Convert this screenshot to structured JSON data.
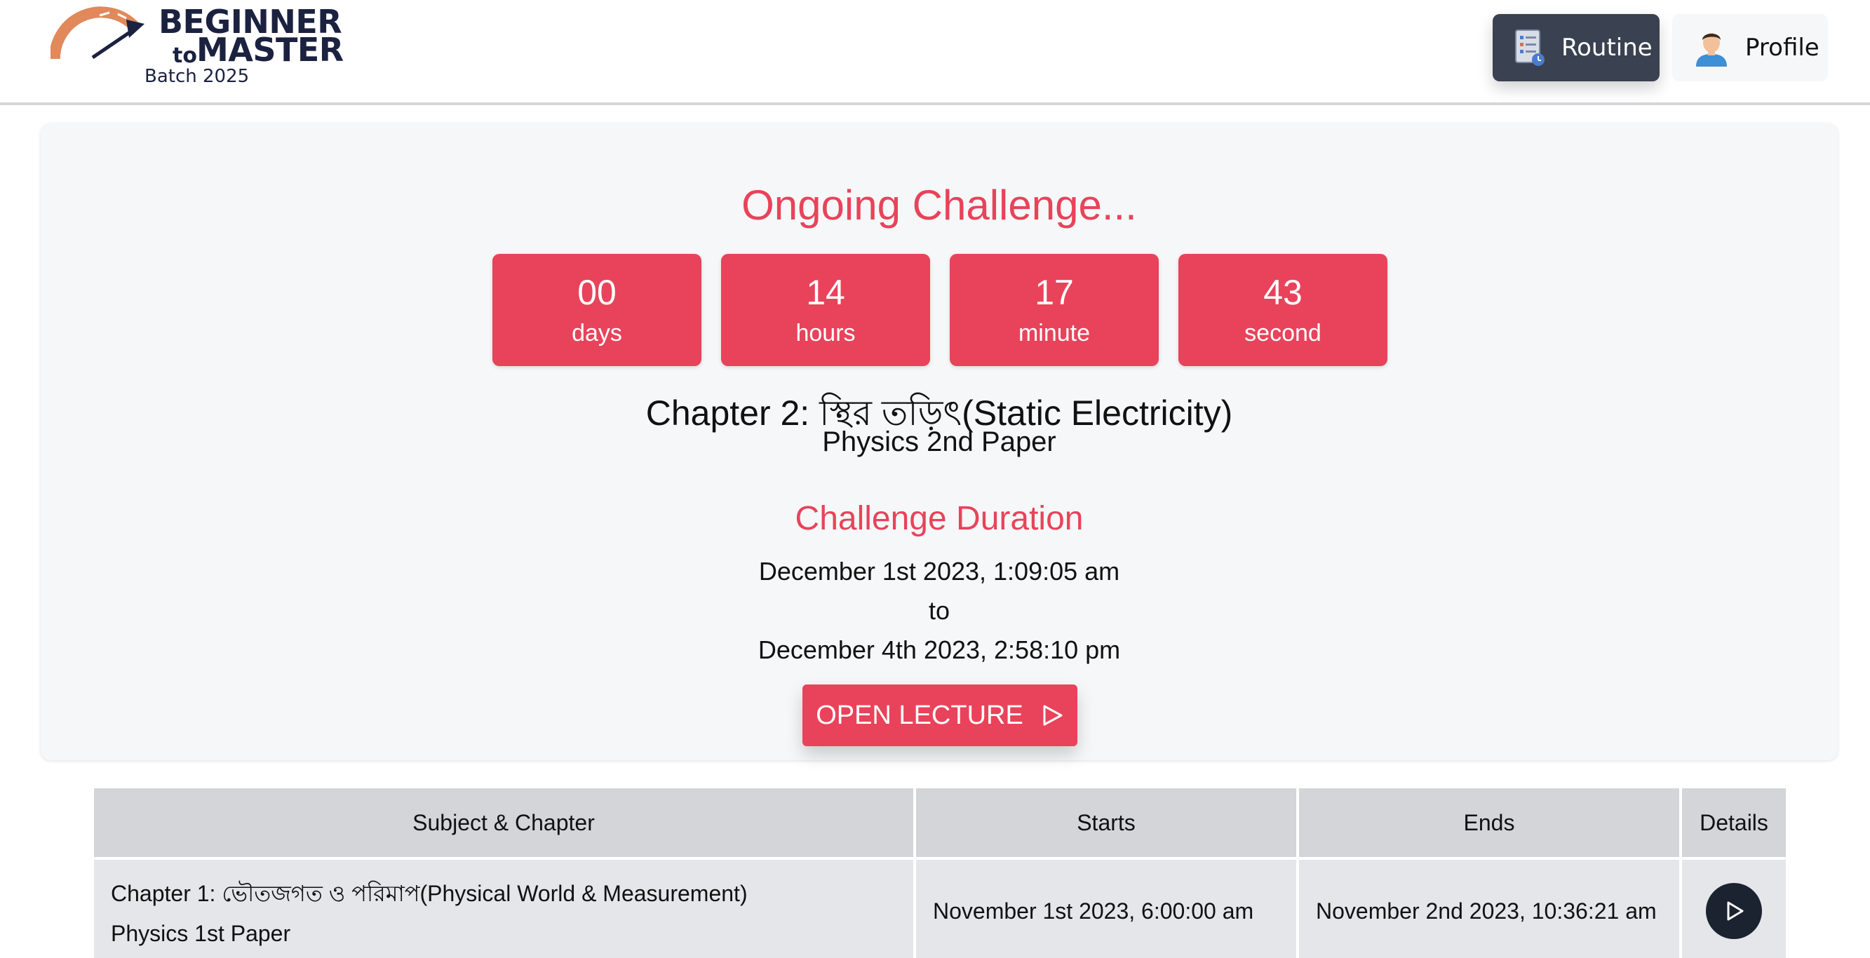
{
  "header": {
    "logo": {
      "line1": "BEGINNER",
      "to": "to",
      "line2": "MASTER",
      "batch": "Batch 2025"
    },
    "nav": {
      "routine_label": "Routine",
      "routine_icon": "document-list-icon",
      "profile_label": "Profile",
      "profile_icon": "user-avatar-icon"
    }
  },
  "challenge": {
    "heading": "Ongoing Challenge...",
    "countdown": [
      {
        "value": "00",
        "unit": "days"
      },
      {
        "value": "14",
        "unit": "hours"
      },
      {
        "value": "17",
        "unit": "minute"
      },
      {
        "value": "43",
        "unit": "second"
      }
    ],
    "chapter": "Chapter 2: স্থির তড়িৎ(Static Electricity)",
    "paper": "Physics 2nd Paper",
    "duration_title": "Challenge Duration",
    "start": "December 1st 2023, 1:09:05 am",
    "to": "to",
    "end": "December 4th 2023, 2:58:10 pm",
    "open_button": "OPEN LECTURE",
    "open_button_icon": "play-outline-icon"
  },
  "table": {
    "headers": [
      "Subject & Chapter",
      "Starts",
      "Ends",
      "Details"
    ],
    "rows": [
      {
        "chapter": "Chapter 1: ভৌতজগত ও পরিমাপ(Physical World & Measurement)",
        "paper": "Physics 1st Paper",
        "starts": "November 1st 2023, 6:00:00 am",
        "ends": "November 2nd 2023, 10:36:21 am",
        "details_icon": "play-circle-icon"
      }
    ]
  },
  "colors": {
    "accent": "#e8435a",
    "dark_button": "#3a4150",
    "card_bg": "#f6f7f8",
    "table_header_bg": "#d3d5d9",
    "table_row_bg": "#e5e6e9"
  }
}
